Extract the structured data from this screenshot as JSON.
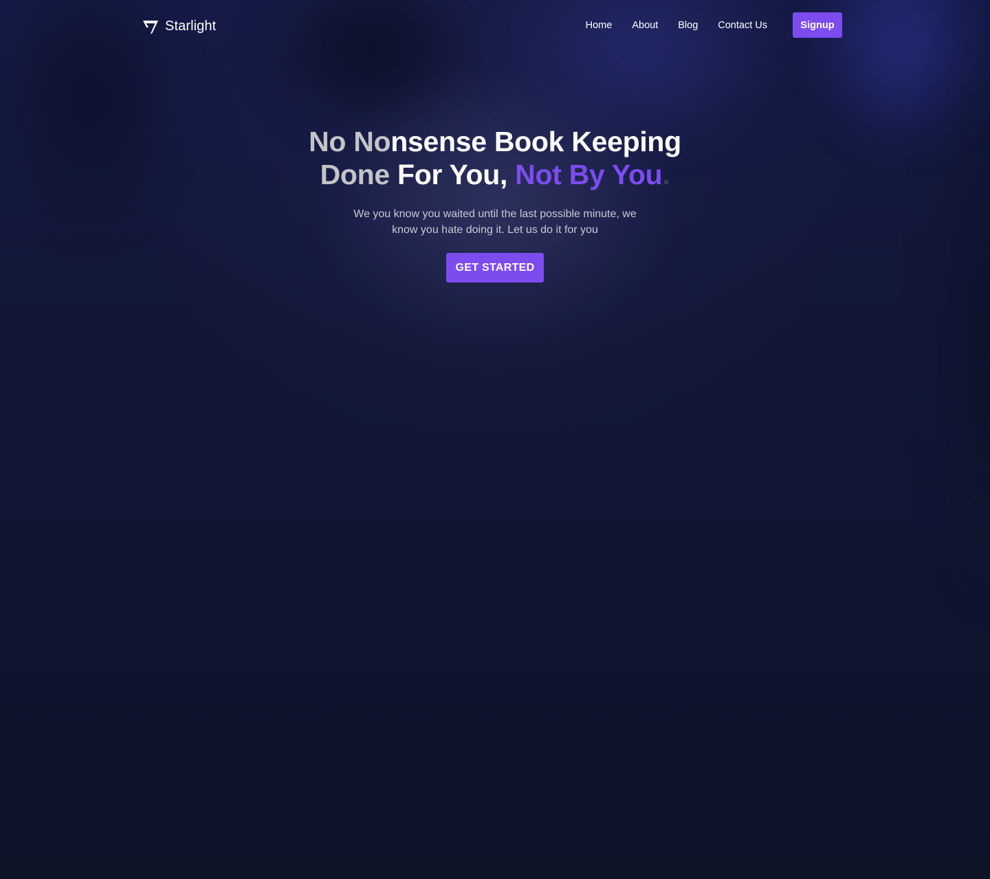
{
  "brand": {
    "name": "Starlight",
    "logo_icon": "check-triangle-icon"
  },
  "nav": {
    "links": [
      "Home",
      "About",
      "Blog",
      "Contact Us"
    ],
    "signup_label": "Signup"
  },
  "hero": {
    "title_line1": {
      "grey": "No No",
      "white": "nsense Book Keeping"
    },
    "title_line2": {
      "grey": "Done",
      "white": " For You, ",
      "purple": "Not By You",
      "dot": "."
    },
    "subtitle": "We you know you waited until the last possible minute, we know you hate doing it. Let us do it for you",
    "cta_label": "GET STARTED"
  },
  "colors": {
    "accent": "#7c4cef",
    "background": "#0e1328",
    "text": "#ffffff"
  }
}
